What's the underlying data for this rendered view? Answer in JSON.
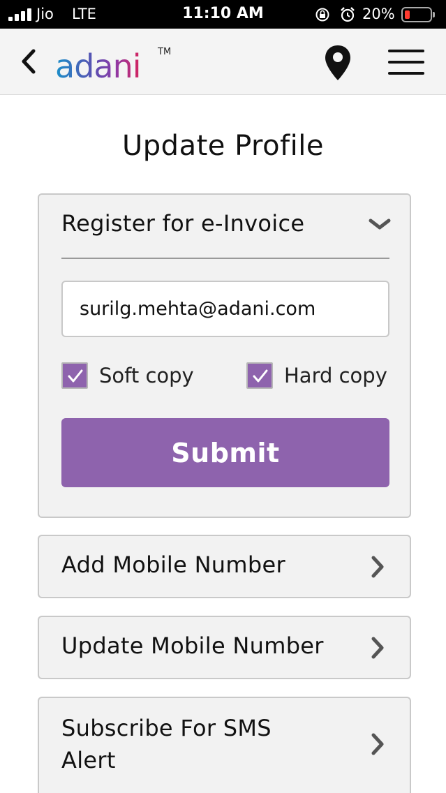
{
  "status_bar": {
    "carrier": "Jio",
    "network": "LTE",
    "time": "11:10 AM",
    "battery": "20%",
    "battery_level": 0.2
  },
  "header": {
    "logo_text": "adani",
    "logo_tm": "TM",
    "icons": [
      "back-icon",
      "location-pin-icon",
      "menu-icon"
    ]
  },
  "page": {
    "title": "Update Profile"
  },
  "einvoice": {
    "title": "Register for e-Invoice",
    "email_value": "surilg.mehta@adani.com",
    "soft_copy_label": "Soft copy",
    "soft_copy_checked": true,
    "hard_copy_label": "Hard copy",
    "hard_copy_checked": true,
    "submit_label": "Submit"
  },
  "menu_items": [
    {
      "label": "Add Mobile Number"
    },
    {
      "label": "Update Mobile Number"
    },
    {
      "label": "Subscribe For SMS Alert"
    }
  ],
  "colors": {
    "accent": "#8e63ad",
    "card_bg": "#f2f2f2",
    "status_bar_bg": "#000000"
  }
}
